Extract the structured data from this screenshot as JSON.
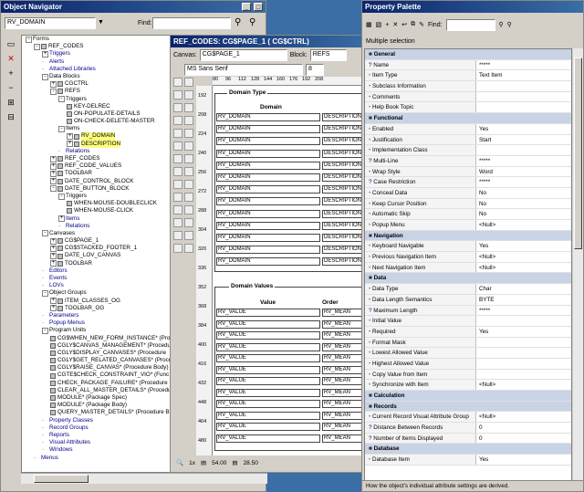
{
  "navigator": {
    "title": "Object Navigator",
    "search_value": "RV_DOMAIN",
    "find_label": "Find:",
    "tree": [
      {
        "label": "Forms",
        "d": 0,
        "exp": "-"
      },
      {
        "label": "REF_CODES",
        "d": 1,
        "exp": "-",
        "icon": true
      },
      {
        "label": "Triggers",
        "d": 2,
        "exp": "+",
        "blue": true
      },
      {
        "label": "Alerts",
        "d": 2,
        "blue": true
      },
      {
        "label": "Attached Libraries",
        "d": 2,
        "blue": true
      },
      {
        "label": "Data Blocks",
        "d": 2,
        "exp": "-"
      },
      {
        "label": "CGCTRL",
        "d": 3,
        "exp": "+",
        "icon": true
      },
      {
        "label": "REFS",
        "d": 3,
        "exp": "-",
        "icon": true
      },
      {
        "label": "Triggers",
        "d": 4,
        "exp": "-"
      },
      {
        "label": "KEY-DELREC",
        "d": 5,
        "icon": true
      },
      {
        "label": "ON-POPULATE-DETAILS",
        "d": 5,
        "icon": true
      },
      {
        "label": "ON-CHECK-DELETE-MASTER",
        "d": 5,
        "icon": true
      },
      {
        "label": "Items",
        "d": 4,
        "exp": "-"
      },
      {
        "label": "RV_DOMAIN",
        "d": 5,
        "exp": "+",
        "icon": true,
        "hl": true
      },
      {
        "label": "DESCRIPTION",
        "d": 5,
        "exp": "+",
        "icon": true,
        "hl": true
      },
      {
        "label": "Relations",
        "d": 4,
        "blue": true
      },
      {
        "label": "REF_CODES",
        "d": 3,
        "exp": "+",
        "icon": true
      },
      {
        "label": "REF_CODE_VALUES",
        "d": 3,
        "exp": "+",
        "icon": true
      },
      {
        "label": "TOOLBAR",
        "d": 3,
        "exp": "+",
        "icon": true
      },
      {
        "label": "DATE_CONTROL_BLOCK",
        "d": 3,
        "exp": "+",
        "icon": true
      },
      {
        "label": "DATE_BUTTON_BLOCK",
        "d": 3,
        "exp": "-",
        "icon": true
      },
      {
        "label": "Triggers",
        "d": 4,
        "exp": "-"
      },
      {
        "label": "WHEN-MOUSE-DOUBLECLICK",
        "d": 5,
        "icon": true
      },
      {
        "label": "WHEN-MOUSE-CLICK",
        "d": 5,
        "icon": true
      },
      {
        "label": "Items",
        "d": 4,
        "exp": "+",
        "blue": true
      },
      {
        "label": "Relations",
        "d": 4,
        "blue": true
      },
      {
        "label": "Canvases",
        "d": 2,
        "exp": "-"
      },
      {
        "label": "CG$PAGE_1",
        "d": 3,
        "exp": "+",
        "icon": true
      },
      {
        "label": "CG$STACKED_FOOTER_1",
        "d": 3,
        "exp": "+",
        "icon": true
      },
      {
        "label": "DATE_LOV_CANVAS",
        "d": 3,
        "exp": "+",
        "icon": true
      },
      {
        "label": "TOOLBAR",
        "d": 3,
        "exp": "+",
        "icon": true
      },
      {
        "label": "Editors",
        "d": 2,
        "blue": true
      },
      {
        "label": "Events",
        "d": 2,
        "blue": true
      },
      {
        "label": "LOVs",
        "d": 2,
        "blue": true
      },
      {
        "label": "Object Groups",
        "d": 2,
        "exp": "-"
      },
      {
        "label": "ITEM_CLASSES_OG",
        "d": 3,
        "exp": "+",
        "icon": true
      },
      {
        "label": "TOOLBAR_OG",
        "d": 3,
        "exp": "+",
        "icon": true
      },
      {
        "label": "Parameters",
        "d": 2,
        "blue": true
      },
      {
        "label": "Popup Menus",
        "d": 2,
        "blue": true
      },
      {
        "label": "Program Units",
        "d": 2,
        "exp": "-"
      },
      {
        "label": "CG$WHEN_NEW_FORM_INSTANCE* (Procedure",
        "d": 3,
        "icon": true
      },
      {
        "label": "CGLY$CANVAS_MANAGEMENT* (Procedur",
        "d": 3,
        "icon": true
      },
      {
        "label": "CGLY$DISPLAY_CANVASES* (Procedure",
        "d": 3,
        "icon": true
      },
      {
        "label": "CGLY$GET_RELATED_CANVASES* (Procedure",
        "d": 3,
        "icon": true
      },
      {
        "label": "CGLY$RAISE_CANVAS* (Procedure Body)",
        "d": 3,
        "icon": true
      },
      {
        "label": "CGTE$CHECK_CONSTRAINT_VIO* (Func",
        "d": 3,
        "icon": true
      },
      {
        "label": "CHECK_PACKAGE_FAILURE* (Procedure",
        "d": 3,
        "icon": true
      },
      {
        "label": "CLEAR_ALL_MASTER_DETAILS* (Procedure",
        "d": 3,
        "icon": true
      },
      {
        "label": "MODULE* (Package Spec)",
        "d": 3,
        "icon": true
      },
      {
        "label": "MODULE* (Package Body)",
        "d": 3,
        "icon": true
      },
      {
        "label": "QUERY_MASTER_DETAILS* (Procedure B",
        "d": 3,
        "icon": true
      },
      {
        "label": "Property Classes",
        "d": 2,
        "blue": true
      },
      {
        "label": "Record Groups",
        "d": 2,
        "blue": true
      },
      {
        "label": "Reports",
        "d": 2,
        "blue": true
      },
      {
        "label": "Visual Attributes",
        "d": 2,
        "blue": true
      },
      {
        "label": "Windows",
        "d": 2,
        "blue": true
      },
      {
        "label": "Menus",
        "d": 1,
        "blue": true
      }
    ]
  },
  "layout": {
    "title": "REF_CODES: CG$PAGE_1 ( CG$CTRL)",
    "canvas_label": "Canvas:",
    "canvas_value": "CG$PAGE_1",
    "block_label": "Block:",
    "block_value": "REFS",
    "font_value": "MS Sans Serif",
    "font_size": "8",
    "ruler": [
      "80",
      "96",
      "112",
      "128",
      "144",
      "160",
      "176",
      "192",
      "208"
    ],
    "vruler": [
      "192",
      "208",
      "224",
      "240",
      "256",
      "272",
      "288",
      "304",
      "320",
      "336",
      "352",
      "368",
      "384",
      "400",
      "416",
      "432",
      "448",
      "464",
      "480"
    ],
    "frame1_title": "Domain Type",
    "frame1_header": "Domain",
    "domain_cells": [
      "RV_DOMAIN",
      "RV_DOMAIN",
      "RV_DOMAIN",
      "RV_DOMAIN",
      "RV_DOMAIN",
      "RV_DOMAIN",
      "RV_DOMAIN",
      "RV_DOMAIN",
      "RV_DOMAIN",
      "RV_DOMAIN",
      "RV_DOMAIN",
      "RV_DOMAIN",
      "RV_DOMAIN"
    ],
    "desc_cells": [
      "DESCRIPTION",
      "DESCRIPTION",
      "DESCRIPTION",
      "DESCRIPTION",
      "DESCRIPTION",
      "DESCRIPTION",
      "DESCRIPTION",
      "DESCRIPTION",
      "DESCRIPTION",
      "DESCRIPTION",
      "DESCRIPTION",
      "DESCRIPTION",
      "DESCRIPTION"
    ],
    "frame2_title": "Domain Values",
    "frame2_header_value": "Value",
    "frame2_header_order": "Order",
    "value_cells": [
      "RV_VALUE",
      "RV_VALUE",
      "RV_VALUE",
      "RV_VALUE",
      "RV_VALUE",
      "RV_VALUE",
      "RV_VALUE",
      "RV_VALUE",
      "RV_VALUE",
      "RV_VALUE",
      "RV_VALUE",
      "RV_VALUE"
    ],
    "order_cells": [
      "RV_MEAN",
      "RV_MEAN",
      "RV_MEAN",
      "RV_MEAN",
      "RV_MEAN",
      "RV_MEAN",
      "RV_MEAN",
      "RV_MEAN",
      "RV_MEAN",
      "RV_MEAN",
      "RV_MEAN",
      "RV_MEAN"
    ],
    "zoom": "1x",
    "pos_x": "54.00",
    "pos_y": "28.50"
  },
  "palette": {
    "title": "Property Palette",
    "find_label": "Find:",
    "subtitle": "Multiple selection",
    "rows": [
      {
        "cat": true,
        "k": "General"
      },
      {
        "k": "Name",
        "v": "*****",
        "mark": "?"
      },
      {
        "k": "Item Type",
        "v": "Text Item"
      },
      {
        "k": "Subclass Information",
        "v": ""
      },
      {
        "k": "Comments",
        "v": ""
      },
      {
        "k": "Help Book Topic",
        "v": ""
      },
      {
        "cat": true,
        "k": "Functional"
      },
      {
        "k": "Enabled",
        "v": "Yes"
      },
      {
        "k": "Justification",
        "v": "Start"
      },
      {
        "k": "Implementation Class",
        "v": ""
      },
      {
        "k": "Multi-Line",
        "v": "*****",
        "mark": "?"
      },
      {
        "k": "Wrap Style",
        "v": "Word"
      },
      {
        "k": "Case Restriction",
        "v": "*****",
        "mark": "?"
      },
      {
        "k": "Conceal Data",
        "v": "No"
      },
      {
        "k": "Keep Cursor Position",
        "v": "No"
      },
      {
        "k": "Automatic Skip",
        "v": "No"
      },
      {
        "k": "Popup Menu",
        "v": "<Null>"
      },
      {
        "cat": true,
        "k": "Navigation"
      },
      {
        "k": "Keyboard Navigable",
        "v": "Yes"
      },
      {
        "k": "Previous Navigation Item",
        "v": "<Null>"
      },
      {
        "k": "Next Navigation Item",
        "v": "<Null>"
      },
      {
        "cat": true,
        "k": "Data"
      },
      {
        "k": "Data Type",
        "v": "Char"
      },
      {
        "k": "Data Length Semantics",
        "v": "BYTE"
      },
      {
        "k": "Maximum Length",
        "v": "*****",
        "mark": "?"
      },
      {
        "k": "Initial Value",
        "v": ""
      },
      {
        "k": "Required",
        "v": "Yes"
      },
      {
        "k": "Format Mask",
        "v": ""
      },
      {
        "k": "Lowest Allowed Value",
        "v": ""
      },
      {
        "k": "Highest Allowed Value",
        "v": ""
      },
      {
        "k": "Copy Value from Item",
        "v": ""
      },
      {
        "k": "Synchronize with Item",
        "v": "<Null>"
      },
      {
        "cat": true,
        "k": "Calculation"
      },
      {
        "cat": true,
        "k": "Records"
      },
      {
        "k": "Current Record Visual Attribute Group",
        "v": "<Null>"
      },
      {
        "k": "Distance Between Records",
        "v": "0",
        "mark": "?"
      },
      {
        "k": "Number of Items Displayed",
        "v": "0",
        "mark": "?"
      },
      {
        "cat": true,
        "k": "Database"
      },
      {
        "k": "Database Item",
        "v": "Yes"
      }
    ],
    "hint": "How the object's individual attribute settings are derived."
  }
}
